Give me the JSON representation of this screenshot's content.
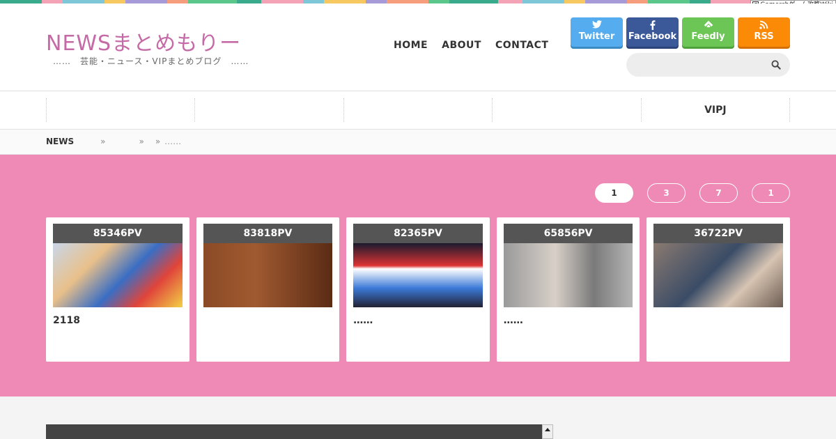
{
  "top_stripe_colors": [
    "#3aaa8c",
    "#f4a3b7",
    "#7ec7d8",
    "#f6c85f",
    "#a69bd8",
    "#f59d7c",
    "#5cc78a",
    "#3aaa8c",
    "#f4a3b7",
    "#7ec7d8",
    "#f6c85f",
    "#a69bd8",
    "#f59d7c",
    "#5cc78a",
    "#3aaa8c",
    "#f4a3b7",
    "#7ec7d8",
    "#f6c85f",
    "#a69bd8",
    "#f59d7c",
    "#5cc78a",
    "#3aaa8c",
    "#f4a3b7",
    "#7ec7d8"
  ],
  "overlay_badge": "Gamerchゲーム攻略Wiki",
  "site": {
    "logo": "NEWSまとめもりー",
    "tagline": "……　芸能・ニュース・VIPまとめブログ　……"
  },
  "nav": {
    "home": "HOME",
    "about": "ABOUT",
    "contact": "CONTACT"
  },
  "social": {
    "twitter": "Twitter",
    "facebook": "Facebook",
    "feedly": "Feedly",
    "rss": "RSS"
  },
  "search": {
    "placeholder": ""
  },
  "categories": [
    "",
    "",
    "",
    "",
    "VIPJ"
  ],
  "breadcrumb": {
    "home": "NEWS",
    "sep1": "»",
    "level2": "",
    "sep2": "»",
    "sep3": "»",
    "current": "……"
  },
  "ranking_tabs": [
    {
      "label": "1",
      "active": true
    },
    {
      "label": "3",
      "active": false
    },
    {
      "label": "7",
      "active": false
    },
    {
      "label": "1",
      "active": false
    }
  ],
  "cards": [
    {
      "pv": "85346PV",
      "title": "2118",
      "thumb": "manga-cover-image"
    },
    {
      "pv": "83818PV",
      "title": "",
      "thumb": "girl-portrait-image"
    },
    {
      "pv": "82365PV",
      "title": "……",
      "thumb": "legoland-image"
    },
    {
      "pv": "65856PV",
      "title": "……",
      "thumb": "couple-street-image"
    },
    {
      "pv": "36722PV",
      "title": "",
      "thumb": "medical-procedure-image"
    }
  ],
  "colors": {
    "pink_band": "#ef8ab6",
    "logo": "#c56aa6",
    "pv_header": "#555555"
  }
}
